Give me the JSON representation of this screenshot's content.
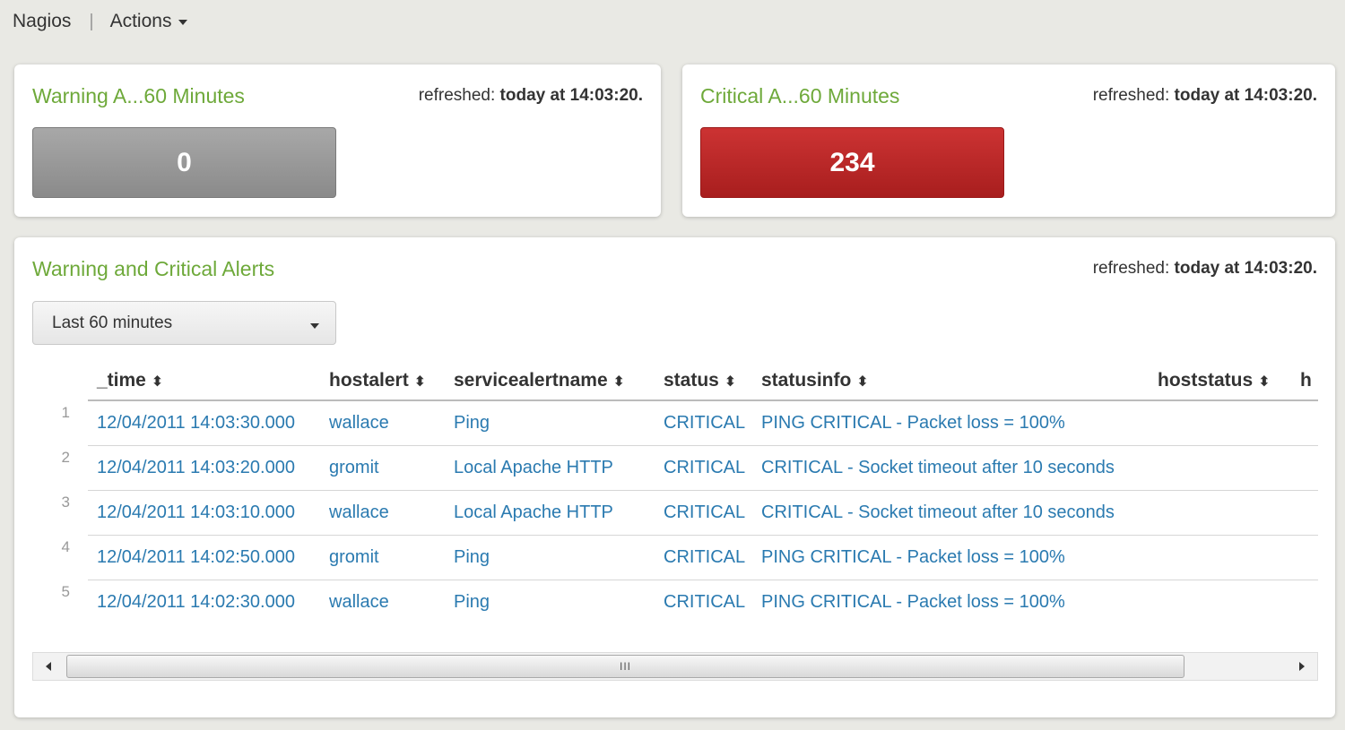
{
  "topbar": {
    "app_name": "Nagios",
    "separator": "|",
    "actions_label": "Actions"
  },
  "warning_panel": {
    "title": "Warning A...60 Minutes",
    "refreshed_label": "refreshed:",
    "refreshed_value": "today at 14:03:20.",
    "count": "0",
    "count_color": "#999999"
  },
  "critical_panel": {
    "title": "Critical A...60 Minutes",
    "refreshed_label": "refreshed:",
    "refreshed_value": "today at 14:03:20.",
    "count": "234",
    "count_color": "#b82424"
  },
  "alerts_panel": {
    "title": "Warning and Critical Alerts",
    "refreshed_label": "refreshed:",
    "refreshed_value": "today at 14:03:20.",
    "time_range": "Last 60 minutes",
    "sort_icon": "sort-arrows-icon",
    "columns": [
      "_time",
      "hostalert",
      "servicealertname",
      "status",
      "statusinfo",
      "hoststatus",
      "h"
    ],
    "rows": [
      {
        "num": "1",
        "time": "12/04/2011 14:03:30.000",
        "host": "wallace",
        "service": "Ping",
        "status": "CRITICAL",
        "info": "PING CRITICAL - Packet loss = 100%"
      },
      {
        "num": "2",
        "time": "12/04/2011 14:03:20.000",
        "host": "gromit",
        "service": "Local Apache HTTP",
        "status": "CRITICAL",
        "info": "CRITICAL - Socket timeout after 10 seconds"
      },
      {
        "num": "3",
        "time": "12/04/2011 14:03:10.000",
        "host": "wallace",
        "service": "Local Apache HTTP",
        "status": "CRITICAL",
        "info": "CRITICAL - Socket timeout after 10 seconds"
      },
      {
        "num": "4",
        "time": "12/04/2011 14:02:50.000",
        "host": "gromit",
        "service": "Ping",
        "status": "CRITICAL",
        "info": "PING CRITICAL - Packet loss = 100%"
      },
      {
        "num": "5",
        "time": "12/04/2011 14:02:30.000",
        "host": "wallace",
        "service": "Ping",
        "status": "CRITICAL",
        "info": "PING CRITICAL - Packet loss = 100%"
      }
    ],
    "scrollbar_grip": "III"
  },
  "colors": {
    "title_green": "#6ea93a",
    "link_blue": "#2a7ab0",
    "background": "#e9e9e4"
  }
}
